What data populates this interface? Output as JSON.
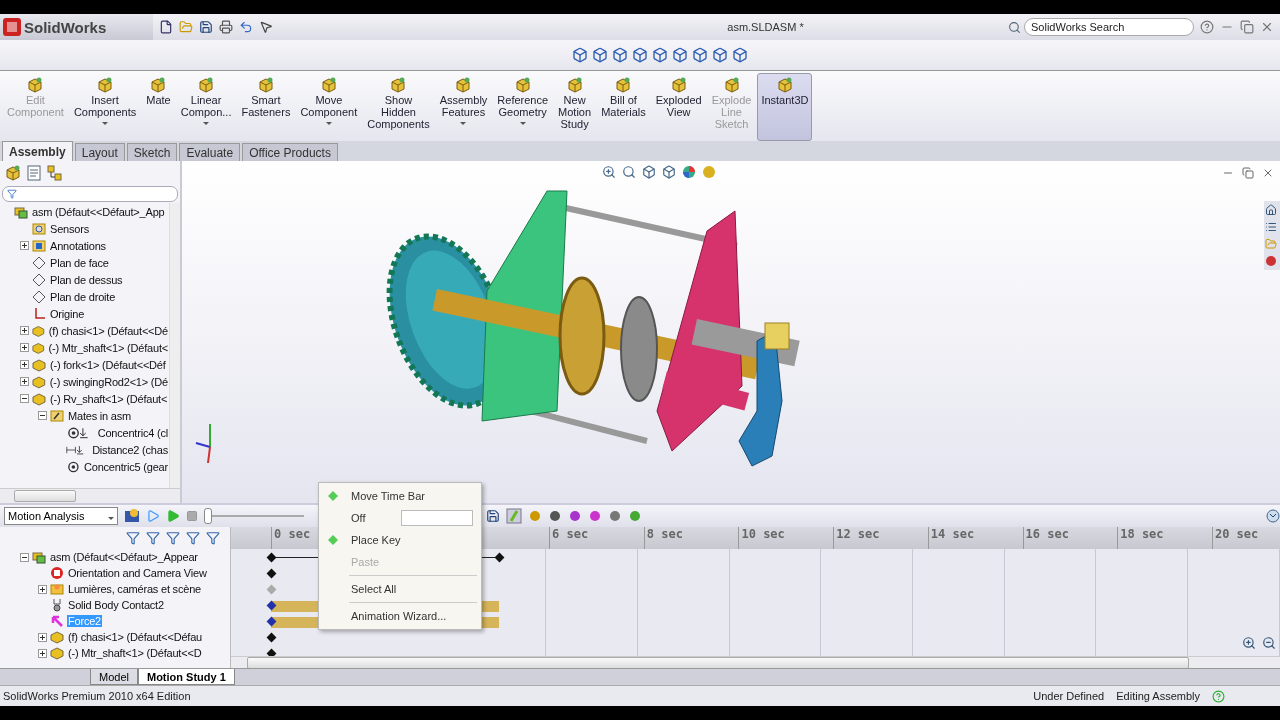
{
  "title_bar": {
    "app_name": "SolidWorks",
    "document_title": "asm.SLDASM *",
    "search_placeholder": "SolidWorks Search"
  },
  "ribbon": {
    "commands": [
      {
        "label": "Edit\nComponent",
        "disabled": true,
        "active": false,
        "dropdown": false
      },
      {
        "label": "Insert\nComponents",
        "disabled": false,
        "active": false,
        "dropdown": true
      },
      {
        "label": "Mate",
        "disabled": false,
        "active": false,
        "dropdown": false
      },
      {
        "label": "Linear\nCompon...",
        "disabled": false,
        "active": false,
        "dropdown": true
      },
      {
        "label": "Smart\nFasteners",
        "disabled": false,
        "active": false,
        "dropdown": false
      },
      {
        "label": "Move\nComponent",
        "disabled": false,
        "active": false,
        "dropdown": true
      },
      {
        "label": "Show\nHidden\nComponents",
        "disabled": false,
        "active": false,
        "dropdown": false
      },
      {
        "label": "Assembly\nFeatures",
        "disabled": false,
        "active": false,
        "dropdown": true
      },
      {
        "label": "Reference\nGeometry",
        "disabled": false,
        "active": false,
        "dropdown": true
      },
      {
        "label": "New\nMotion\nStudy",
        "disabled": false,
        "active": false,
        "dropdown": false
      },
      {
        "label": "Bill of\nMaterials",
        "disabled": false,
        "active": false,
        "dropdown": false
      },
      {
        "label": "Exploded\nView",
        "disabled": false,
        "active": false,
        "dropdown": false
      },
      {
        "label": "Explode\nLine\nSketch",
        "disabled": true,
        "active": false,
        "dropdown": false
      },
      {
        "label": "Instant3D",
        "disabled": false,
        "active": true,
        "dropdown": false
      }
    ],
    "tabs": [
      {
        "label": "Assembly",
        "selected": true
      },
      {
        "label": "Layout",
        "selected": false
      },
      {
        "label": "Sketch",
        "selected": false
      },
      {
        "label": "Evaluate",
        "selected": false
      },
      {
        "label": "Office Products",
        "selected": false
      }
    ]
  },
  "feature_tree": {
    "items": [
      {
        "kind": "assembly",
        "label": "asm  (Défaut<<Défaut>_App",
        "children": [
          {
            "kind": "sensor",
            "label": "Sensors"
          },
          {
            "kind": "annotation",
            "label": "Annotations",
            "expanded": false
          },
          {
            "kind": "plane",
            "label": "Plan de face"
          },
          {
            "kind": "plane",
            "label": "Plan de dessus"
          },
          {
            "kind": "plane",
            "label": "Plan de droite"
          },
          {
            "kind": "origin",
            "label": "Origine"
          },
          {
            "kind": "part",
            "label": "(f) chasi<1> (Défaut<<Dé",
            "expanded": false
          },
          {
            "kind": "part",
            "label": "(-) Mtr_shaft<1> (Défaut<",
            "expanded": false
          },
          {
            "kind": "part",
            "label": "(-) fork<1> (Défaut<<Déf",
            "expanded": false
          },
          {
            "kind": "part",
            "label": "(-) swingingRod2<1> (Dé",
            "expanded": false
          },
          {
            "kind": "part",
            "label": "(-) Rv_shaft<1> (Défaut<",
            "expanded": true,
            "children": [
              {
                "kind": "mates",
                "label": "Mates in asm",
                "expanded": true,
                "children": [
                  {
                    "kind": "concentric",
                    "label": "Concentric4 (cl"
                  },
                  {
                    "kind": "distance",
                    "label": "Distance2 (chas"
                  },
                  {
                    "kind": "concentric-plain",
                    "label": "Concentric5 (gear"
                  }
                ]
              }
            ]
          }
        ]
      }
    ]
  },
  "motion_manager": {
    "study_type": "Motion Analysis",
    "playback": {
      "level": 0
    },
    "rows": [
      {
        "kind": "assembly",
        "label": "asm  (Défaut<<Défaut>_Appear",
        "selected": false,
        "span": true,
        "bar": false,
        "dimmed": false,
        "expanded": true,
        "children": [
          {
            "kind": "camera",
            "label": "Orientation and Camera View",
            "selected": false,
            "span": false,
            "bar": false,
            "dimmed": false
          },
          {
            "kind": "lights",
            "label": "Lumières, caméras et scène",
            "selected": false,
            "span": false,
            "bar": false,
            "dimmed": true,
            "expanded": false
          },
          {
            "kind": "contact",
            "label": "Solid Body Contact2",
            "selected": false,
            "span": false,
            "bar": true,
            "dimmed": false
          },
          {
            "kind": "force",
            "label": "Force2",
            "selected": true,
            "span": false,
            "bar": true,
            "dimmed": false
          },
          {
            "kind": "part",
            "label": "(f) chasi<1> (Défaut<<Défau",
            "selected": false,
            "span": false,
            "bar": false,
            "dimmed": false,
            "expanded": false
          },
          {
            "kind": "part",
            "label": "(-) Mtr_shaft<1> (Défaut<<D",
            "selected": false,
            "span": false,
            "bar": false,
            "dimmed": false,
            "expanded": false
          }
        ]
      }
    ],
    "start_label": "0 sec",
    "time_labels": [
      "6 sec",
      "8 sec",
      "10 sec",
      "12 sec",
      "14 sec",
      "16 sec",
      "18 sec",
      "20 sec"
    ],
    "study_tabs": [
      {
        "label": "Model",
        "selected": false
      },
      {
        "label": "Motion Study 1",
        "selected": true
      }
    ]
  },
  "context_menu": {
    "items": [
      {
        "kind": "item",
        "label": "Move Time Bar",
        "disabled": false
      },
      {
        "kind": "select",
        "label": "Off",
        "disabled": false
      },
      {
        "kind": "item",
        "label": "Place Key",
        "disabled": false
      },
      {
        "kind": "item",
        "label": "Paste",
        "disabled": true
      },
      {
        "kind": "item",
        "label": "Select All",
        "disabled": false
      },
      {
        "kind": "item",
        "label": "Animation Wizard...",
        "disabled": false
      }
    ]
  },
  "status_bar": {
    "edition": "SolidWorks Premium 2010 x64 Edition",
    "state": "Under Defined",
    "mode": "Editing Assembly"
  }
}
